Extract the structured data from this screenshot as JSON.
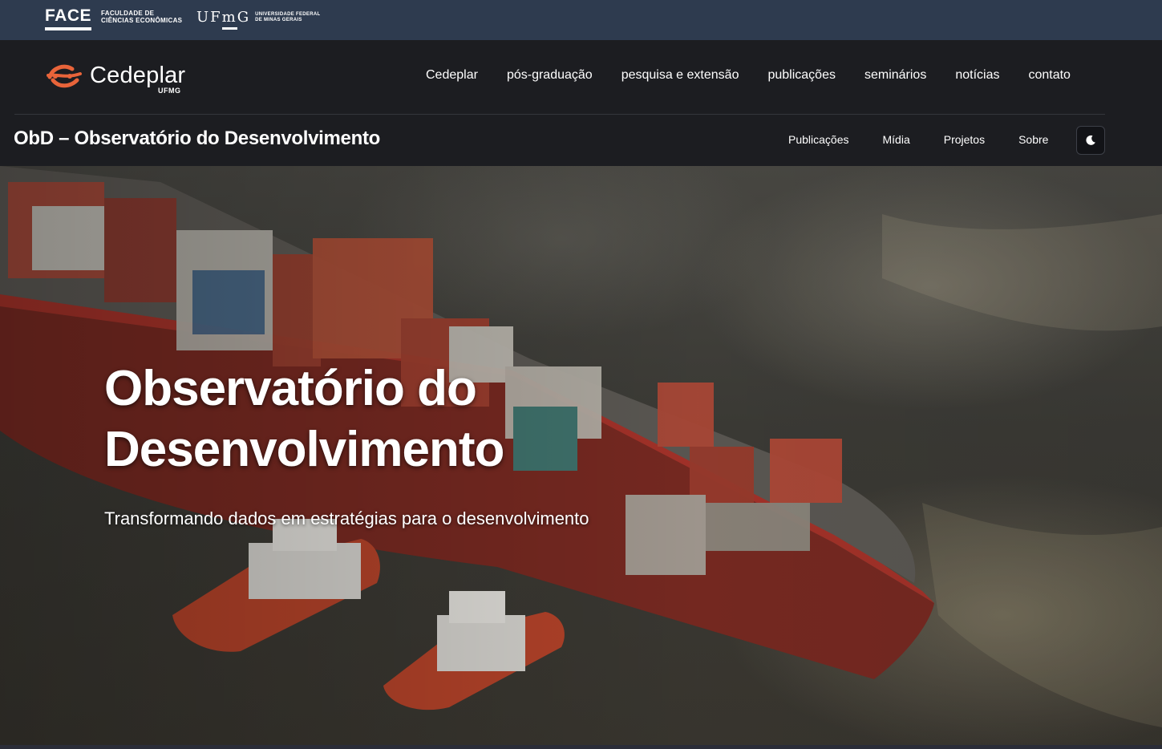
{
  "institution": {
    "face_word": "FACE",
    "face_sub_line1": "Faculdade de",
    "face_sub_line2": "Ciências Econômicas",
    "ufmg_word": "UFmG",
    "ufmg_sub_line1": "Universidade Federal",
    "ufmg_sub_line2": "de Minas Gerais"
  },
  "brand": {
    "name": "Cedeplar",
    "sub": "UFMG",
    "logo_color": "#e8643a"
  },
  "menu": {
    "items": [
      {
        "label": "Cedeplar"
      },
      {
        "label": "pós-graduação"
      },
      {
        "label": "pesquisa e extensão"
      },
      {
        "label": "publicações"
      },
      {
        "label": "seminários"
      },
      {
        "label": "notícias"
      },
      {
        "label": "contato"
      }
    ]
  },
  "section": {
    "title": "ObD – Observatório do Desenvolvimento",
    "nav": [
      {
        "label": "Publicações"
      },
      {
        "label": "Mídia"
      },
      {
        "label": "Projetos"
      },
      {
        "label": "Sobre"
      }
    ],
    "theme_icon": "moon-icon"
  },
  "hero": {
    "title_line1": "Observatório do",
    "title_line2": "Desenvolvimento",
    "tagline": "Transformando dados em estratégias para o desenvolvimento",
    "image": "container-ship-with-tugboats-photo"
  },
  "colors": {
    "topbar": "#2e3b4f",
    "nav_bg": "#1c1d21",
    "accent": "#e8643a"
  }
}
